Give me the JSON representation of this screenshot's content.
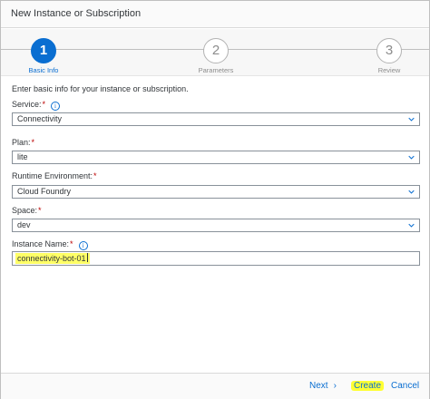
{
  "dialog": {
    "title": "New Instance or Subscription"
  },
  "wizard": {
    "steps": [
      {
        "number": "1",
        "label": "Basic Info"
      },
      {
        "number": "2",
        "label": "Parameters"
      },
      {
        "number": "3",
        "label": "Review"
      }
    ]
  },
  "form": {
    "intro": "Enter basic info for your instance or subscription.",
    "service": {
      "label": "Service:",
      "value": "Connectivity"
    },
    "plan": {
      "label": "Plan:",
      "value": "lite"
    },
    "runtime": {
      "label": "Runtime Environment:",
      "value": "Cloud Foundry"
    },
    "space": {
      "label": "Space:",
      "value": "dev"
    },
    "instance_name": {
      "label": "Instance Name:",
      "value": "connectivity-bot-01"
    },
    "required_mark": "*",
    "info_glyph": "i"
  },
  "footer": {
    "next_label": "Next",
    "next_arrow": "›",
    "create_label": "Create",
    "cancel_label": "Cancel"
  },
  "colors": {
    "accent": "#0a6ed1",
    "highlight": "#ffff33",
    "required": "#bb0000"
  }
}
